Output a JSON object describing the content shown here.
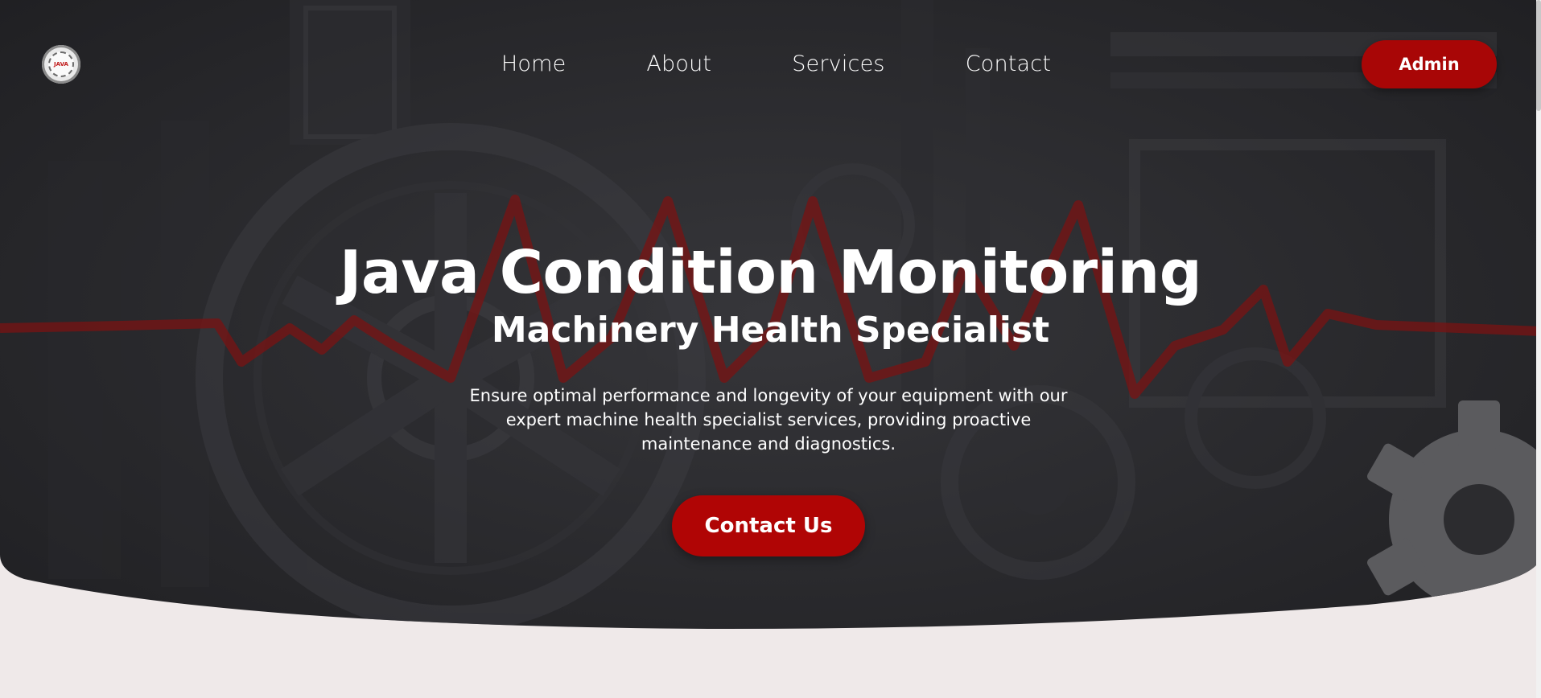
{
  "nav": {
    "logo_text": "JAVA",
    "links": [
      "Home",
      "About",
      "Services",
      "Contact"
    ],
    "admin_label": "Admin"
  },
  "hero": {
    "title": "Java Condition Monitoring",
    "subtitle": "Machinery Health Specialist",
    "description": "Ensure optimal performance and longevity of your equipment with our expert machine health specialist services, providing proactive maintenance and diagnostics.",
    "cta_label": "Contact Us"
  },
  "colors": {
    "hero_bg": "#232326",
    "accent_red": "#a80606",
    "page_bg": "#efe9e9",
    "heartbeat_line": "#8a1414",
    "gear_icon": "#5a5a5c"
  },
  "icons": {
    "logo": "bearing-logo-icon",
    "decoration": "gear-icon",
    "background": "heartbeat-line-icon"
  }
}
